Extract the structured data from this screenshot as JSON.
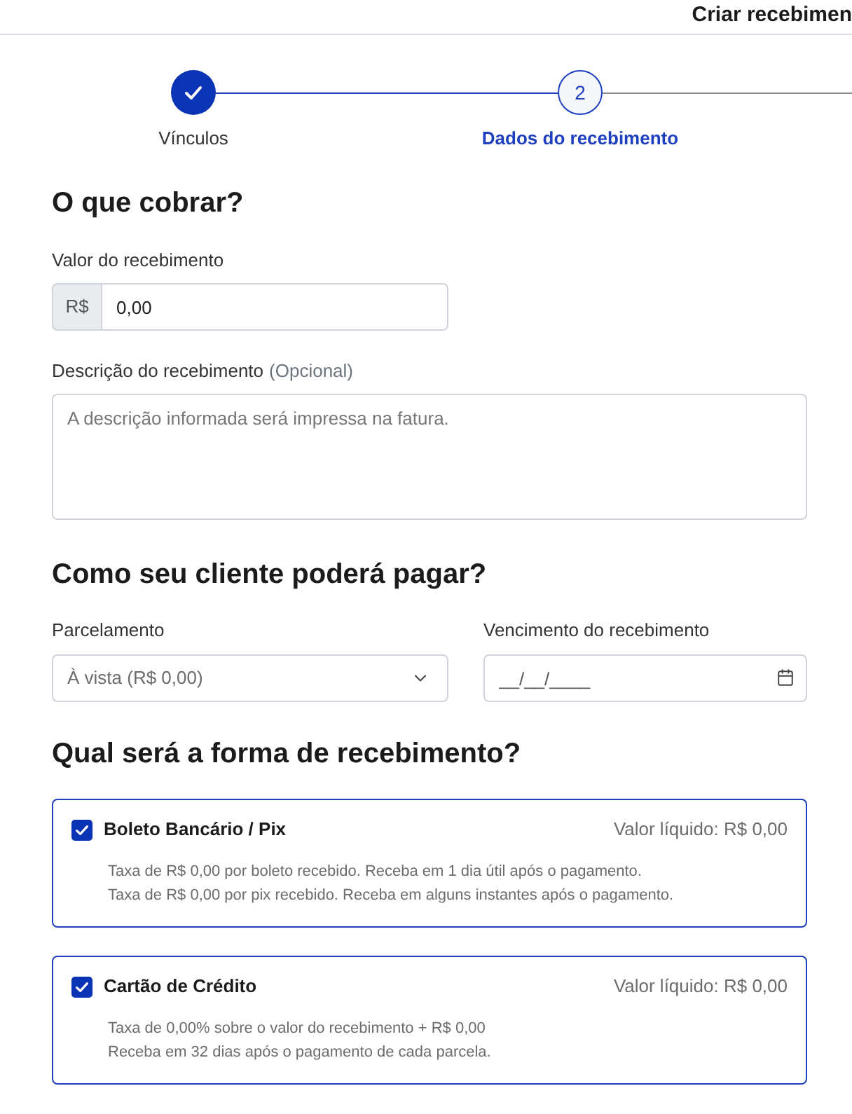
{
  "header": {
    "title": "Criar recebimen"
  },
  "stepper": {
    "steps": [
      {
        "label": "Vínculos",
        "completed": true,
        "selected": false
      },
      {
        "label": "Dados do recebimento",
        "number": "2",
        "completed": false,
        "selected": true
      }
    ]
  },
  "charge_section": {
    "heading": "O que cobrar?",
    "amount": {
      "label": "Valor do recebimento",
      "prefix": "R$",
      "value": "0,00"
    },
    "description": {
      "label": "Descrição do recebimento",
      "hint": "(Opcional)",
      "placeholder": "A descrição informada será impressa na fatura."
    }
  },
  "payment_section": {
    "heading": "Como seu cliente poderá pagar?",
    "installments": {
      "label": "Parcelamento",
      "value": "À vista (R$ 0,00)"
    },
    "due_date": {
      "label": "Vencimento do recebimento",
      "placeholder": "__/__/____"
    }
  },
  "methods_section": {
    "heading": "Qual será a forma de recebimento?",
    "methods": [
      {
        "title": "Boleto Bancário / Pix",
        "checked": true,
        "net_value": "Valor líquido: R$ 0,00",
        "details": [
          "Taxa de R$ 0,00 por boleto recebido. Receba em 1 dia útil após o pagamento.",
          "Taxa de R$ 0,00 por pix recebido. Receba em alguns instantes após o pagamento."
        ]
      },
      {
        "title": "Cartão de Crédito",
        "checked": true,
        "net_value": "Valor líquido: R$ 0,00",
        "details": [
          "Taxa de 0,00% sobre o valor do recebimento + R$ 0,00",
          "Receba em 32 dias após o pagamento de cada parcela."
        ]
      }
    ]
  }
}
